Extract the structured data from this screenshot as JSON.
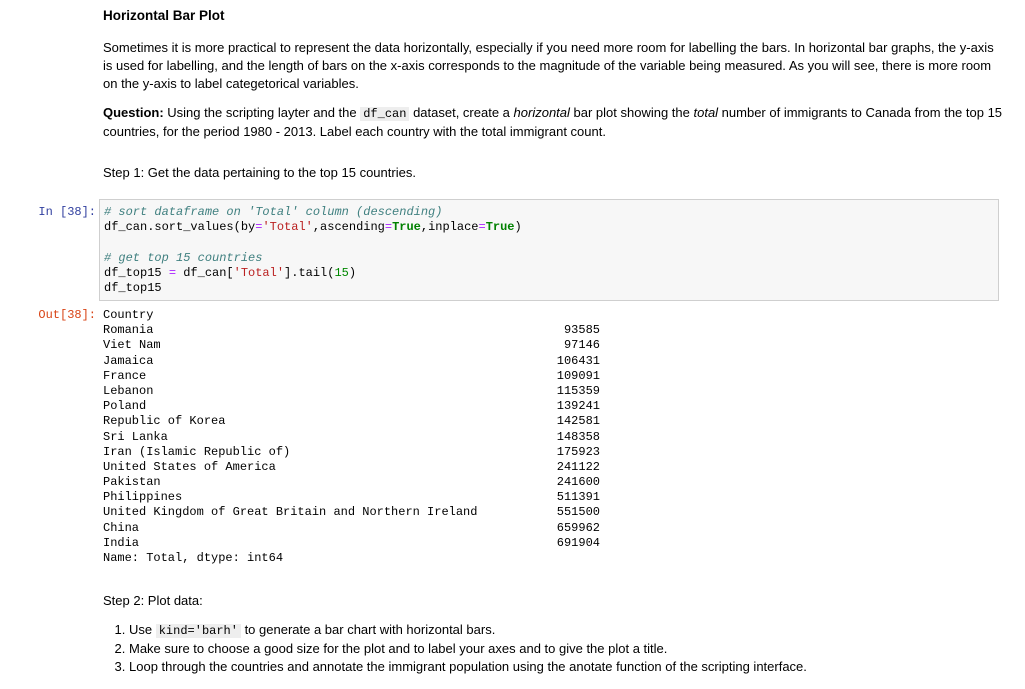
{
  "heading": "Horizontal Bar Plot",
  "intro": "Sometimes it is more practical to represent the data horizontally, especially if you need more room for labelling the bars. In horizontal bar graphs, the y-axis is used for labelling, and the length of bars on the x-axis corresponds to the magnitude of the variable being measured. As you will see, there is more room on the y-axis to label categetorical variables.",
  "question": {
    "label": "Question:",
    "text_a": " Using the scripting layter and the ",
    "code": "df_can",
    "text_b": " dataset, create a ",
    "em1": "horizontal",
    "text_c": " bar plot showing the ",
    "em2": "total",
    "text_d": " number of immigrants to Canada from the top 15 countries, for the period 1980 - 2013. Label each country with the total immigrant count."
  },
  "step1": "Step 1: Get the data pertaining to the top 15 countries.",
  "in_prompt": "In [38]:",
  "out_prompt": "Out[38]:",
  "code_cell": {
    "c1": "# sort dataframe on 'Total' column (descending)",
    "l2a": "df_can.sort_values(by",
    "l2eq": "=",
    "l2s": "'Total'",
    "l2b": ",ascending",
    "l2eq2": "=",
    "l2k": "True",
    "l2c": ",inplace",
    "l2eq3": "=",
    "l2k2": "True",
    "l2d": ")",
    "c2": "# get top 15 countries",
    "l5a": "df_top15 ",
    "l5eq": "=",
    "l5b": " df_can[",
    "l5s": "'Total'",
    "l5c": "].tail(",
    "l5n": "15",
    "l5d": ")",
    "l6": "df_top15"
  },
  "output": {
    "header": "Country",
    "rows": [
      {
        "name": "Romania",
        "value": "93585"
      },
      {
        "name": "Viet Nam",
        "value": "97146"
      },
      {
        "name": "Jamaica",
        "value": "106431"
      },
      {
        "name": "France",
        "value": "109091"
      },
      {
        "name": "Lebanon",
        "value": "115359"
      },
      {
        "name": "Poland",
        "value": "139241"
      },
      {
        "name": "Republic of Korea",
        "value": "142581"
      },
      {
        "name": "Sri Lanka",
        "value": "148358"
      },
      {
        "name": "Iran (Islamic Republic of)",
        "value": "175923"
      },
      {
        "name": "United States of America",
        "value": "241122"
      },
      {
        "name": "Pakistan",
        "value": "241600"
      },
      {
        "name": "Philippines",
        "value": "511391"
      },
      {
        "name": "United Kingdom of Great Britain and Northern Ireland",
        "value": "551500"
      },
      {
        "name": "China",
        "value": "659962"
      },
      {
        "name": "India",
        "value": "691904"
      }
    ],
    "footer": "Name: Total, dtype: int64"
  },
  "step2": "Step 2: Plot data:",
  "steps": {
    "s1a": "Use ",
    "s1code": "kind='barh'",
    "s1b": " to generate a bar chart with horizontal bars.",
    "s2": "Make sure to choose a good size for the plot and to label your axes and to give the plot a title.",
    "s3": "Loop through the countries and annotate the immigrant population using the anotate function of the scripting interface."
  }
}
